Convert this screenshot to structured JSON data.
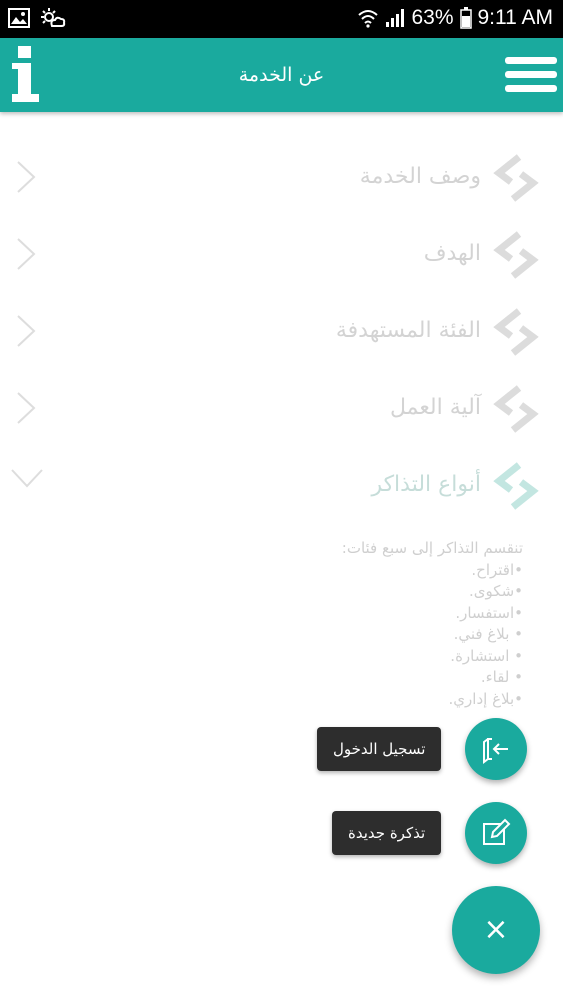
{
  "status_bar": {
    "battery": "63%",
    "time": "9:11 AM"
  },
  "app_bar": {
    "title": "عن الخدمة"
  },
  "list": {
    "items": [
      {
        "label": "وصف الخدمة"
      },
      {
        "label": "الهدف"
      },
      {
        "label": "الفئة المستهدفة"
      },
      {
        "label": "آلية العمل"
      },
      {
        "label": "أنواع التذاكر"
      }
    ]
  },
  "ticket_types": {
    "intro": "تنقسم التذاكر إلى سبع فئات:",
    "lines": [
      "•اقتراح.",
      "•شكوى.",
      "•استفسار.",
      "• بلاغ فني.",
      "• استشارة.",
      "• لقاء.",
      "•بلاغ إداري."
    ]
  },
  "fab_menu": {
    "login_label": "تسجيل الدخول",
    "new_ticket_label": "تذكرة جديدة",
    "close_symbol": "×"
  },
  "colors": {
    "primary": "#1aaa9e",
    "label_bg": "#2d2d2d"
  }
}
